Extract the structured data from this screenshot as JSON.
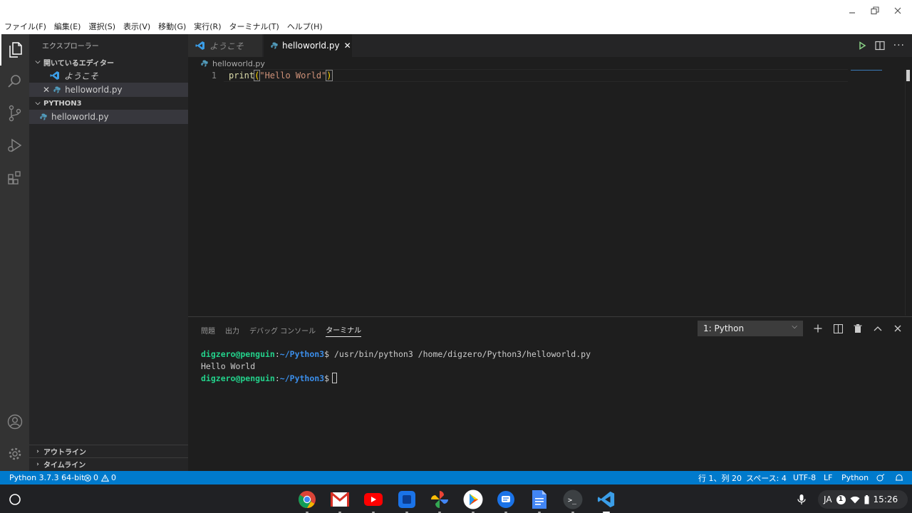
{
  "menu": {
    "items": [
      "ファイル(F)",
      "編集(E)",
      "選択(S)",
      "表示(V)",
      "移動(G)",
      "実行(R)",
      "ターミナル(T)",
      "ヘルプ(H)"
    ]
  },
  "sidebar": {
    "title": "エクスプローラー",
    "open_editors": {
      "label": "開いているエディター",
      "items": [
        {
          "label": "ようこそ",
          "icon": "vscode-icon"
        },
        {
          "label": "helloworld.py",
          "icon": "python-icon"
        }
      ]
    },
    "folder": {
      "label": "PYTHON3",
      "items": [
        {
          "label": "helloworld.py",
          "icon": "python-icon"
        }
      ]
    },
    "outline_label": "アウトライン",
    "timeline_label": "タイムライン"
  },
  "tabs": [
    {
      "label": "ようこそ",
      "active": false
    },
    {
      "label": "helloworld.py",
      "active": true
    }
  ],
  "editor": {
    "breadcrumb": "helloworld.py",
    "line_number": "1",
    "code": {
      "fn": "print",
      "open": "(",
      "string": "\"Hello World\"",
      "close": ")"
    }
  },
  "panel": {
    "tabs": [
      "問題",
      "出力",
      "デバッグ コンソール",
      "ターミナル"
    ],
    "active_tab": "ターミナル",
    "terminal_select": "1: Python",
    "terminal": {
      "user": "digzero@penguin",
      "colon": ":",
      "path": "~/Python3",
      "prompt": "$",
      "command": " /usr/bin/python3 /home/digzero/Python3/helloworld.py",
      "output": "Hello World"
    }
  },
  "statusbar": {
    "interpreter": "Python 3.7.3 64-bit",
    "errors": "0",
    "warnings": "0",
    "position": "行 1、列 20",
    "spaces": "スペース: 4",
    "encoding": "UTF-8",
    "eol": "LF",
    "language": "Python"
  },
  "shelf": {
    "apps": [
      "chrome-icon",
      "gmail-icon",
      "youtube-icon",
      "tasks-icon",
      "photos-icon",
      "play-store-icon",
      "messages-icon",
      "docs-icon",
      "terminal-icon",
      "vscode-icon"
    ],
    "ime": "JA",
    "notification_count": "1",
    "time": "15:26"
  },
  "colors": {
    "accent": "#007acc",
    "activity_bar": "#333333",
    "sidebar": "#252526",
    "editor_bg": "#1e1e1e",
    "python_blue": "#519aba"
  }
}
